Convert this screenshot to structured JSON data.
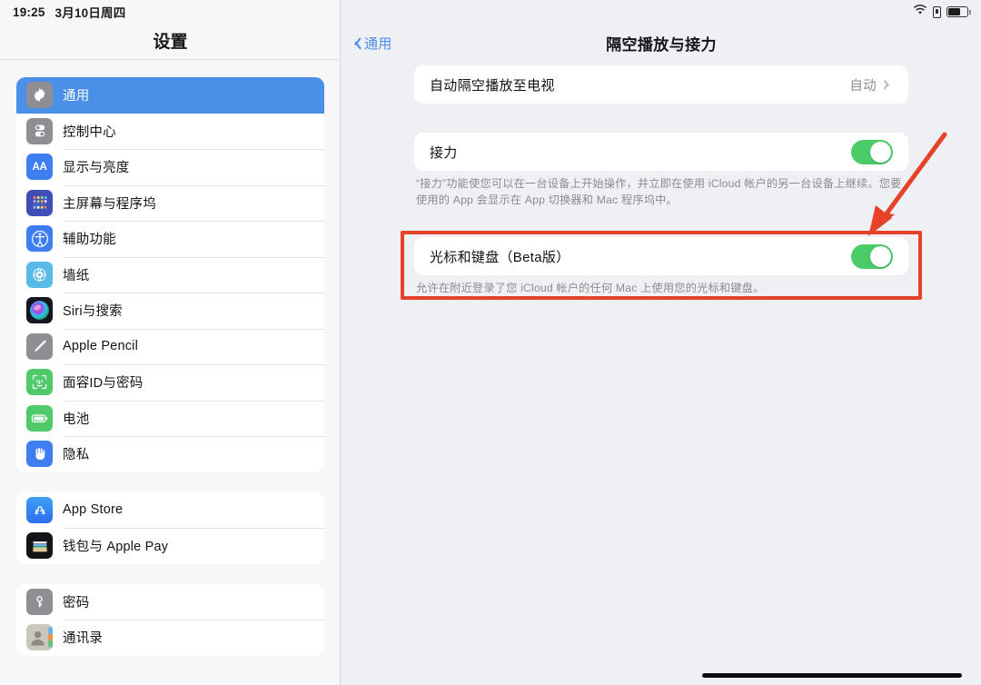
{
  "status_bar": {
    "time": "19:25",
    "date": "3月10日周四",
    "wifi_icon": "wifi-icon",
    "lock_icon": "rotation-lock-icon",
    "battery_icon": "battery-icon"
  },
  "sidebar": {
    "title": "设置",
    "groups": [
      {
        "items": [
          {
            "label": "通用",
            "icon": "gear-icon",
            "icon_color": "#8e8e93",
            "selected": true
          },
          {
            "label": "控制中心",
            "icon": "control-center-icon",
            "icon_color": "#8e8e93",
            "selected": false
          },
          {
            "label": "显示与亮度",
            "icon": "display-brightness-icon",
            "icon_color": "#3f7ef0",
            "selected": false
          },
          {
            "label": "主屏幕与程序坞",
            "icon": "home-screen-dock-icon",
            "icon_color": "#3f4fb5",
            "selected": false
          },
          {
            "label": "辅助功能",
            "icon": "accessibility-icon",
            "icon_color": "#3f7ef0",
            "selected": false
          },
          {
            "label": "墙纸",
            "icon": "wallpaper-icon",
            "icon_color": "#59b9e8",
            "selected": false
          },
          {
            "label": "Siri与搜索",
            "icon": "siri-icon",
            "icon_color": "#1a1a2a",
            "selected": false
          },
          {
            "label": "Apple Pencil",
            "icon": "apple-pencil-icon",
            "icon_color": "#8e8e93",
            "selected": false
          },
          {
            "label": "面容ID与密码",
            "icon": "face-id-icon",
            "icon_color": "#4fc96a",
            "selected": false
          },
          {
            "label": "电池",
            "icon": "battery-settings-icon",
            "icon_color": "#4fc96a",
            "selected": false
          },
          {
            "label": "隐私",
            "icon": "privacy-hand-icon",
            "icon_color": "#3f7ef0",
            "selected": false
          }
        ]
      },
      {
        "items": [
          {
            "label": "App Store",
            "icon": "app-store-icon",
            "icon_color": "#3f8ff0",
            "selected": false
          },
          {
            "label": "钱包与 Apple Pay",
            "icon": "wallet-icon",
            "icon_color": "#141417",
            "selected": false
          }
        ]
      },
      {
        "items": [
          {
            "label": "密码",
            "icon": "passwords-key-icon",
            "icon_color": "#8e8e93",
            "selected": false
          },
          {
            "label": "通讯录",
            "icon": "contacts-icon",
            "icon_color": "#c8c4ba",
            "selected": false
          }
        ]
      }
    ]
  },
  "detail": {
    "back_label": "通用",
    "title": "隔空播放与接力",
    "sections": [
      {
        "rows": [
          {
            "title": "自动隔空播放至电视",
            "value": "自动",
            "accessory": "chevron"
          }
        ],
        "footnote": ""
      },
      {
        "rows": [
          {
            "title": "接力",
            "accessory": "toggle",
            "toggle_on": true
          }
        ],
        "footnote": "“接力”功能使您可以在一台设备上开始操作，并立即在使用 iCloud 帐户的另一台设备上继续。您要使用的 App 会显示在 App 切换器和 Mac 程序坞中。"
      },
      {
        "rows": [
          {
            "title": "光标和键盘（Beta版）",
            "accessory": "toggle",
            "toggle_on": true
          }
        ],
        "footnote": "允许在附近登录了您 iCloud 帐户的任何 Mac 上使用您的光标和键盘。",
        "highlighted": true
      }
    ]
  },
  "annotation": {
    "highlight_color": "#e8412a",
    "arrow_color": "#e8412a"
  },
  "colors": {
    "accent_blue": "#4a8cf0",
    "selected_row_blue": "#4a90e8",
    "toggle_green": "#4ccc69",
    "pane_background": "#eff0f4",
    "sidebar_background": "#f7f7f9"
  }
}
